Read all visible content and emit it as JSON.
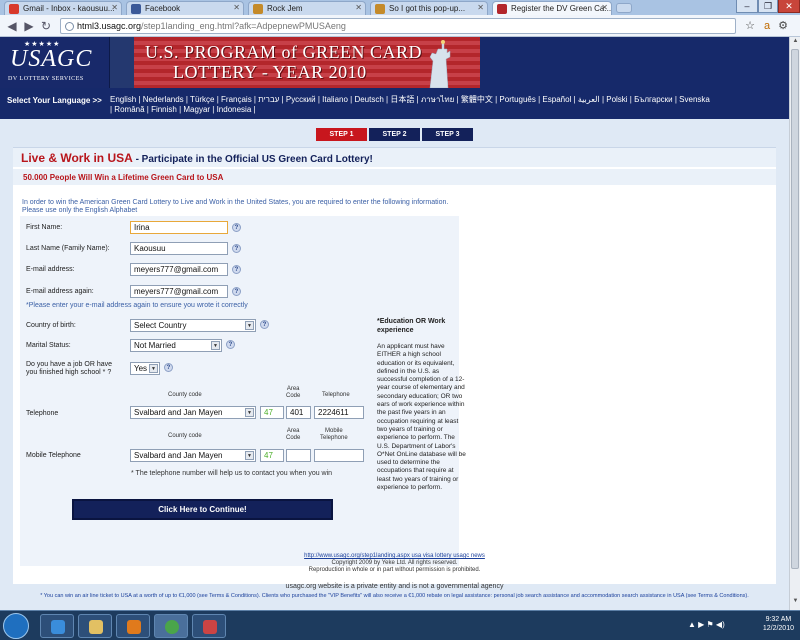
{
  "browser": {
    "tabs": [
      {
        "title": "Gmail - Inbox - kaousuu...",
        "active": false,
        "favicon_color": "#d8392b"
      },
      {
        "title": "Facebook",
        "active": false,
        "favicon_color": "#3b5998"
      },
      {
        "title": "Rock Jem",
        "active": false,
        "favicon_color": "#c48a2a"
      },
      {
        "title": "So I got this pop-up...",
        "active": false,
        "favicon_color": "#c48a2a"
      },
      {
        "title": "Register the DV Green Ca...",
        "active": true,
        "favicon_color": "#b3262b"
      }
    ],
    "url_host": "html3.usagc.org",
    "url_path": "/step1landing_eng.html?afk=AdpepnewPMUSAeng"
  },
  "banner": {
    "logo_stars": "★★★★★",
    "logo_name": "USAGC",
    "logo_sub": "DV LOTTERY SERVICES",
    "title_line1": "U.S. PROGRAM of GREEN CARD",
    "title_line2": "LOTTERY - YEAR 2010"
  },
  "langbar": {
    "label": "Select Your Language >>",
    "languages": "English | Nederlands | Türkçe | Français | עברית | Русский | Italiano | Deutsch | 日本語 | ภาษาไทย | 繁體中文 | Português | Español | العربية | Polski | Български | Svenska | Română | Finnish | Magyar | Indonesia |"
  },
  "steps": [
    "STEP 1",
    "STEP 2",
    "STEP 3"
  ],
  "heading": {
    "main": "Live & Work in USA",
    "rest": " - Participate in the Official US Green Card Lottery!",
    "sub": "50.000 People Will Win a Lifetime Green Card to USA"
  },
  "intro": {
    "line1": "In order to win the American Green Card Lottery to Live and Work in the United States, you are required to enter the following information.",
    "line2": "Please use only the English Alphabet"
  },
  "form": {
    "first_name_label": "First Name:",
    "first_name_value": "Irina",
    "last_name_label": "Last Name (Family Name):",
    "last_name_value": "Kaousuu",
    "email_label": "E-mail address:",
    "email_value": "meyers777@gmail.com",
    "email2_label": "E-mail address again:",
    "email2_value": "meyers777@gmail.com",
    "email_note": "*Please enter your e-mail address again to ensure you wrote it correctly",
    "country_label": "Country of birth:",
    "country_value": "Select Country",
    "marital_label": "Marital Status:",
    "marital_value": "Not Married",
    "job_label_1": "Do you have a job OR have",
    "job_label_2": "you finished high school * ?",
    "job_value": "Yes",
    "telephone_label": "Telephone",
    "mobile_label": "Mobile Telephone",
    "country_code_label": "County code",
    "area_code_label": "Area\nCode",
    "telephone_col_label": "Telephone",
    "mobile_col_label": "Mobile\nTelephone",
    "tel_country": "Svalbard and Jan Mayen",
    "tel_code": "47",
    "tel_area": "401",
    "tel_number": "2224611",
    "mob_country": "Svalbard and Jan Mayen",
    "mob_code": "47",
    "mob_area": "",
    "mob_number": "",
    "tel_note": "* The telephone number will help us to contact you when you win",
    "submit_label": "Click Here to Continue!",
    "help_glyph": "?"
  },
  "aside": {
    "title": "*Education OR Work experience",
    "body": "An applicant must have EITHER a high school education or its equivalent, defined in the U.S. as successful completion of a 12-year course of elementary and secondary education; OR two ears of work experience within the past five years in an occupation requiring at least two years of training or experience to perform. The U.S. Department of Labor's O*Net OnLine database will be used to determine the occupations that require at least two years of training or experience to perform."
  },
  "footer": {
    "links": "http://www.usagc.org/step1landing.aspx usa visa lottery usagc news",
    "copyright": "Copyright 2009 by Yeke Ltd. All rights reserved.",
    "reproduction": "Reproduction in whole or in part without permission is prohibited.",
    "private": "usagc.org website is a private entity and is not a governmental agency",
    "disclaimer": "* You can win an air line ticket to USA at a worth of up to €1,000 (see Terms & Conditions). Clients who purchased the \"VIP Benefits\" will also receive a €1,000 rebate on legal assistance: personal job search assistance and accommodation search assistance in USA (see Terms & Conditions)."
  },
  "taskbar": {
    "time": "9:32 AM",
    "date": "12/2/2010",
    "tray_icons": "▲ ▶ ⚑ ◀)"
  }
}
